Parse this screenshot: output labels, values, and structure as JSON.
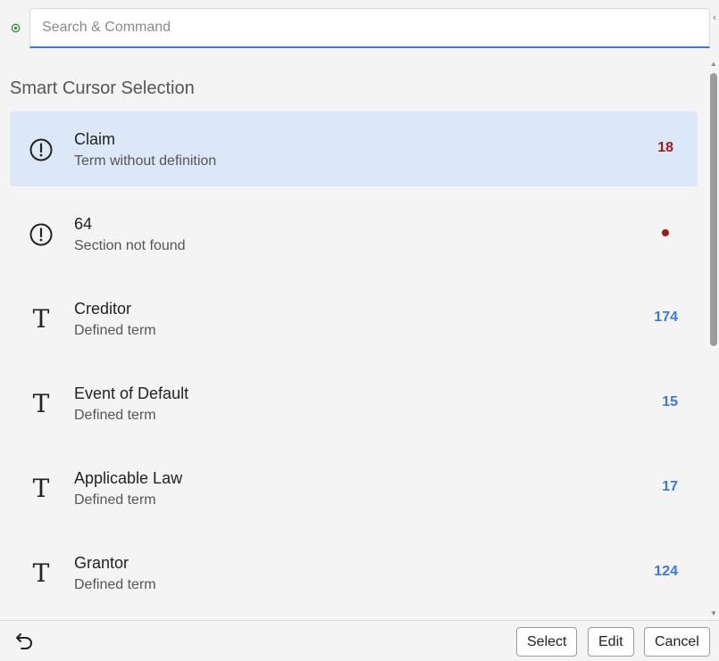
{
  "search": {
    "placeholder": "Search & Command",
    "value": ""
  },
  "section_title": "Smart Cursor Selection",
  "items": [
    {
      "icon": "warning-circle-icon",
      "title": "Claim",
      "subtitle": "Term without definition",
      "count": "18",
      "count_type": "warn",
      "selected": true
    },
    {
      "icon": "warning-circle-icon",
      "title": "64",
      "subtitle": "Section not found",
      "count": "",
      "count_type": "dot",
      "selected": false
    },
    {
      "icon": "term-icon",
      "title": "Creditor",
      "subtitle": "Defined term",
      "count": "174",
      "count_type": "info",
      "selected": false
    },
    {
      "icon": "term-icon",
      "title": "Event of Default",
      "subtitle": "Defined term",
      "count": "15",
      "count_type": "info",
      "selected": false
    },
    {
      "icon": "term-icon",
      "title": "Applicable Law",
      "subtitle": "Defined term",
      "count": "17",
      "count_type": "info",
      "selected": false
    },
    {
      "icon": "term-icon",
      "title": "Grantor",
      "subtitle": "Defined term",
      "count": "124",
      "count_type": "info",
      "selected": false
    }
  ],
  "footer": {
    "select_label": "Select",
    "edit_label": "Edit",
    "cancel_label": "Cancel"
  },
  "colors": {
    "accent": "#3b78d8",
    "warning": "#9b1c1c",
    "selected_bg": "#dce7f7",
    "status_ok": "#2e8b3a"
  }
}
